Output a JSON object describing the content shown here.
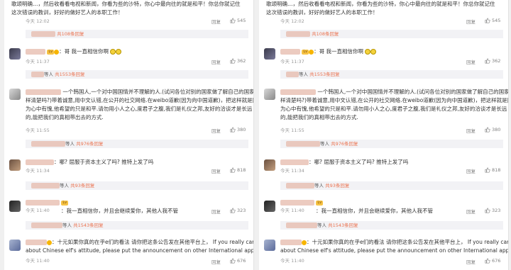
{
  "comments": {
    "top_text": {
      "line1": "歌颂明确…，然后收看看电视和新闻，你看为些的沙特，你心中最向往的就是和平！你总你就记住",
      "line2": "这次错误的教训，好好的做好艺人的本职工作！",
      "time": "今天 12:02",
      "likes": "545"
    },
    "reply1": {
      "suffix": "共108条回复",
      "users": "等人"
    },
    "c2": {
      "text": "：哥 我一直相信你啊",
      "time": "今天 11:37",
      "likes": "362"
    },
    "reply2": {
      "users": "等人",
      "suffix": "共1553条回复"
    },
    "c3": {
      "line1": "一个韩国人,一个对中国国情并不理解的人.(试问各位对别的国家做了解自己的国家一",
      "line2": "样清楚吗?)带着诚意,用中文认错,在公开的社交网络.在weibo道歉(因为向中国道歉)，把这样就是因",
      "line3": "为心中有愧,他希望的只是和平.请勿用小人之心,度君子之腹,我们是礼仪之邦,友好的洽谈才是长远",
      "line4": "的,能把我们的真相带出去的方式.",
      "time": "今天 11:55",
      "likes": "380"
    },
    "reply3": {
      "users": "等人",
      "suffix": "共976条回复"
    },
    "c4": {
      "text": "：哪? 屈服于资本主义了吗? 推特上发了吗",
      "time": "今天 11:34",
      "likes": "818"
    },
    "reply4": {
      "users": "等人",
      "suffix": "共93条回复"
    },
    "c5": {
      "text": "：我一直相信你，并且会继续爱你，其他人我不管",
      "time": "今天 11:40",
      "likes": "323"
    },
    "reply5": {
      "users": "等人",
      "suffix": "共1543条回复"
    },
    "c6": {
      "line1": "：十元如果你真的在乎e们的看法 请你把这条公告发在其他平台上，  If you really care",
      "line2": "about Chinese elf's attitude, please put the announcement on other International applications.",
      "time": "今天 11:40",
      "likes": "676"
    },
    "action_reply": "回复"
  },
  "colors": {
    "link": "#eb7350",
    "text": "#333333",
    "meta": "#9a9a9a",
    "reply_bg": "#f2f2f5"
  }
}
